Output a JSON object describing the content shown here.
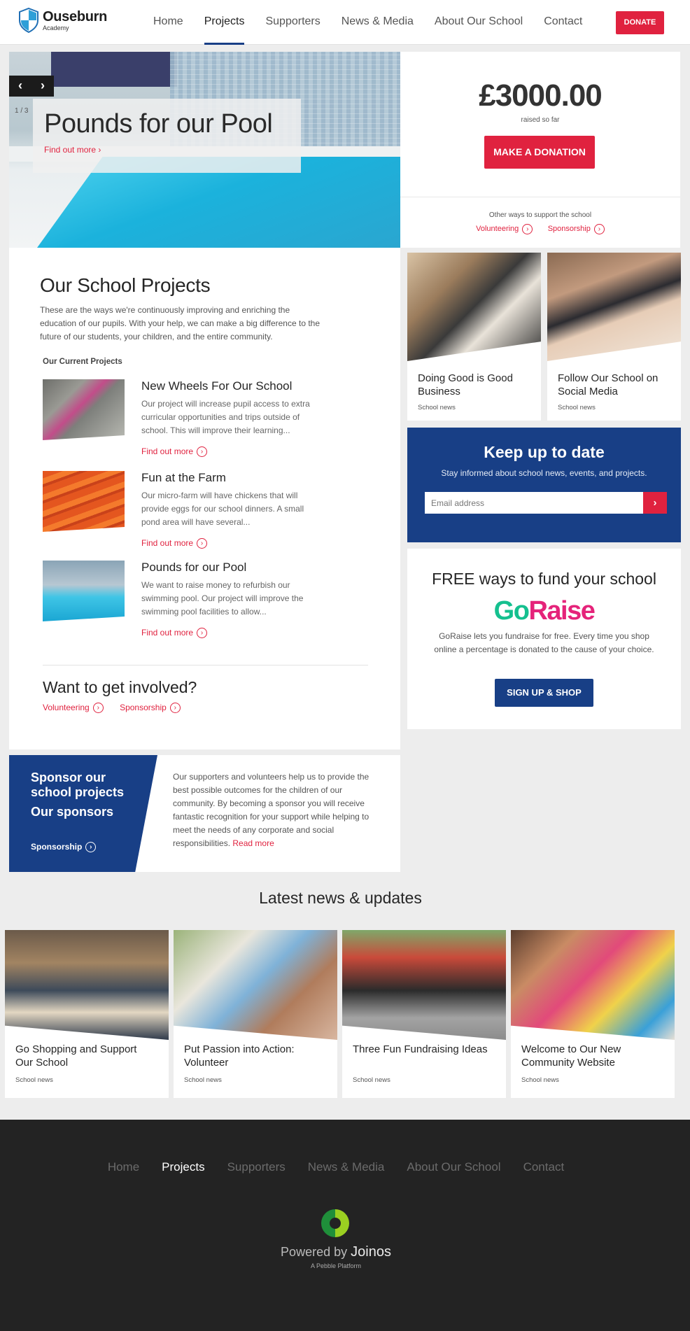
{
  "header": {
    "logo_name": "Ouseburn",
    "logo_sub": "Academy",
    "nav": [
      "Home",
      "Projects",
      "Supporters",
      "News & Media",
      "About Our School",
      "Contact"
    ],
    "active_nav": "Projects",
    "donate_label": "DONATE"
  },
  "hero": {
    "prev": "‹",
    "next": "›",
    "counter": "1 / 3",
    "title": "Pounds for our Pool",
    "link": "Find out more"
  },
  "raised": {
    "amount": "£3000.00",
    "label": "raised so far",
    "button": "MAKE A DONATION",
    "other_ways": "Other ways to support the school",
    "volunteering": "Volunteering",
    "sponsorship": "Sponsorship"
  },
  "projects": {
    "title": "Our School Projects",
    "intro": "These are the ways we're continuously improving and enriching the education of our pupils. With your help, we can make a big difference to the future of our students, your children, and the entire community.",
    "subtitle": "Our Current Projects",
    "items": [
      {
        "name": "New Wheels For Our School",
        "desc": "Our project will increase pupil access to extra curricular opportunities and trips outside of school. This will improve their learning...",
        "more": "Find out more"
      },
      {
        "name": "Fun at the Farm",
        "desc": "Our micro-farm will have chickens that will provide eggs for our school dinners. A small pond area will have several...",
        "more": "Find out more"
      },
      {
        "name": "Pounds for our Pool",
        "desc": "We want to raise money to refurbish our swimming pool. Our project will improve the swimming pool facilities to allow...",
        "more": "Find out more"
      }
    ],
    "involved_title": "Want to get involved?",
    "volunteering": "Volunteering",
    "sponsorship": "Sponsorship"
  },
  "sponsor": {
    "heading": "Sponsor our school projects",
    "heading2": "Our sponsors",
    "link": "Sponsorship",
    "text": "Our supporters and volunteers help us to provide the best possible outcomes for the children of our community. By becoming a sponsor you will receive fantastic recognition for your support while helping to meet the needs of any corporate and social responsibilities.",
    "read_more": "Read more"
  },
  "cards": [
    {
      "title": "Doing Good is Good Business",
      "tag": "School news"
    },
    {
      "title": "Follow Our School on Social Media",
      "tag": "School news"
    }
  ],
  "newsletter": {
    "title": "Keep up to date",
    "subtitle": "Stay informed about school news, events, and projects.",
    "placeholder": "Email address",
    "go": "›"
  },
  "goraise": {
    "title": "FREE ways to fund your school",
    "logo_a": "Go",
    "logo_b": "Raise",
    "text": "GoRaise lets you fundraise for free. Every time you shop online a percentage is donated to the cause of your choice.",
    "button": "SIGN UP & SHOP"
  },
  "news": {
    "heading": "Latest news & updates",
    "items": [
      {
        "title": "Go Shopping and Support Our School",
        "tag": "School news"
      },
      {
        "title": "Put Passion into Action: Volunteer",
        "tag": "School news"
      },
      {
        "title": "Three Fun Fundraising Ideas",
        "tag": "School news"
      },
      {
        "title": "Welcome to Our New Community Website",
        "tag": "School news"
      }
    ]
  },
  "footer": {
    "nav": [
      "Home",
      "Projects",
      "Supporters",
      "News & Media",
      "About Our School",
      "Contact"
    ],
    "powered_prefix": "Powered by",
    "powered_brand": "Joinos",
    "platform": "A Pebble Platform"
  },
  "colors": {
    "brand_blue": "#183f86",
    "accent_red": "#e0223f",
    "goraise_green": "#15c08f",
    "goraise_pink": "#e5237a",
    "footer_bg": "#232323"
  }
}
